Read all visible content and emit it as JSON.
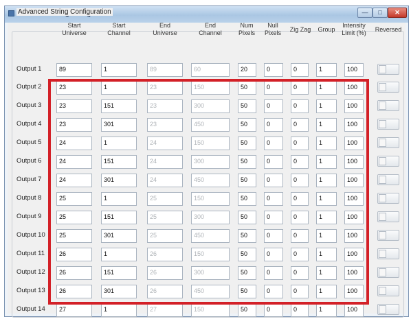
{
  "window": {
    "title": "Advanced String Configuration",
    "min_glyph": "—",
    "max_glyph": "□",
    "close_glyph": "✕"
  },
  "group": {
    "label": "Advanced String Configuration"
  },
  "columns": [
    "Start\nUniverse",
    "Start\nChannel",
    "End\nUniverse",
    "End\nChannel",
    "Num\nPixels",
    "Null\nPixels",
    "Zig Zag",
    "Group",
    "Intensity\nLimit (%)",
    "Reversed"
  ],
  "rows": [
    {
      "label": "Output 1",
      "values": [
        "89",
        "1",
        "89",
        "60",
        "20",
        "0",
        "0",
        "1",
        "100"
      ]
    },
    {
      "label": "Output 2",
      "values": [
        "23",
        "1",
        "23",
        "150",
        "50",
        "0",
        "0",
        "1",
        "100"
      ]
    },
    {
      "label": "Output 3",
      "values": [
        "23",
        "151",
        "23",
        "300",
        "50",
        "0",
        "0",
        "1",
        "100"
      ]
    },
    {
      "label": "Output 4",
      "values": [
        "23",
        "301",
        "23",
        "450",
        "50",
        "0",
        "0",
        "1",
        "100"
      ]
    },
    {
      "label": "Output 5",
      "values": [
        "24",
        "1",
        "24",
        "150",
        "50",
        "0",
        "0",
        "1",
        "100"
      ]
    },
    {
      "label": "Output 6",
      "values": [
        "24",
        "151",
        "24",
        "300",
        "50",
        "0",
        "0",
        "1",
        "100"
      ]
    },
    {
      "label": "Output 7",
      "values": [
        "24",
        "301",
        "24",
        "450",
        "50",
        "0",
        "0",
        "1",
        "100"
      ]
    },
    {
      "label": "Output 8",
      "values": [
        "25",
        "1",
        "25",
        "150",
        "50",
        "0",
        "0",
        "1",
        "100"
      ]
    },
    {
      "label": "Output 9",
      "values": [
        "25",
        "151",
        "25",
        "300",
        "50",
        "0",
        "0",
        "1",
        "100"
      ]
    },
    {
      "label": "Output 10",
      "values": [
        "25",
        "301",
        "25",
        "450",
        "50",
        "0",
        "0",
        "1",
        "100"
      ]
    },
    {
      "label": "Output 11",
      "values": [
        "26",
        "1",
        "26",
        "150",
        "50",
        "0",
        "0",
        "1",
        "100"
      ]
    },
    {
      "label": "Output 12",
      "values": [
        "26",
        "151",
        "26",
        "300",
        "50",
        "0",
        "0",
        "1",
        "100"
      ]
    },
    {
      "label": "Output 13",
      "values": [
        "26",
        "301",
        "26",
        "450",
        "50",
        "0",
        "0",
        "1",
        "100"
      ]
    },
    {
      "label": "Output 14",
      "values": [
        "27",
        "1",
        "27",
        "150",
        "50",
        "0",
        "0",
        "1",
        "100"
      ]
    }
  ],
  "colors": {
    "highlight": "#d32027",
    "title_bar": "#b9d2ea",
    "close_button": "#c4392a"
  }
}
